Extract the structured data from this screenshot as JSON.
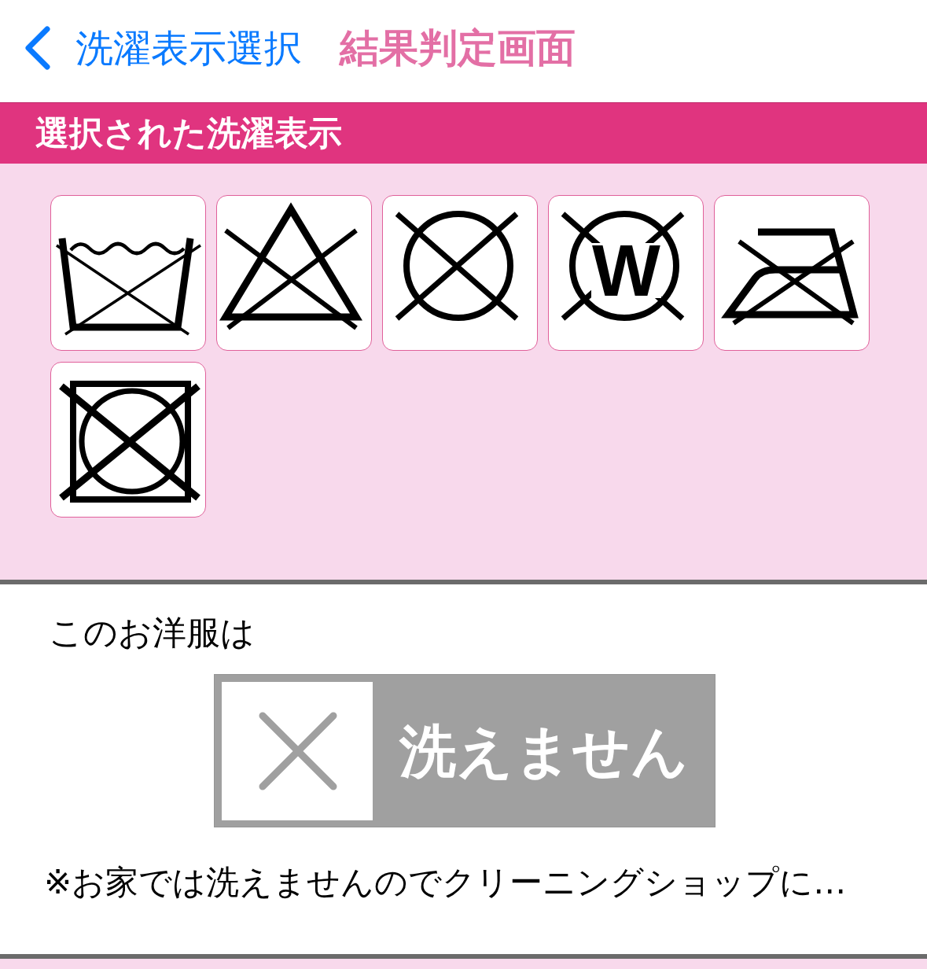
{
  "nav": {
    "back_label": "洗濯表示選択",
    "title": "結果判定画面"
  },
  "selected_symbols": {
    "heading": "選択された洗濯表示",
    "symbols": [
      {
        "kind": "no-wash"
      },
      {
        "kind": "no-bleach"
      },
      {
        "kind": "no-dry-clean"
      },
      {
        "kind": "no-wet-clean",
        "letter": "W"
      },
      {
        "kind": "no-iron"
      },
      {
        "kind": "no-tumble-dry"
      }
    ]
  },
  "result": {
    "intro": "このお洋服は",
    "washable": false,
    "verdict": "洗えません",
    "note": "※お家では洗えませんのでクリーニングショップに…"
  }
}
